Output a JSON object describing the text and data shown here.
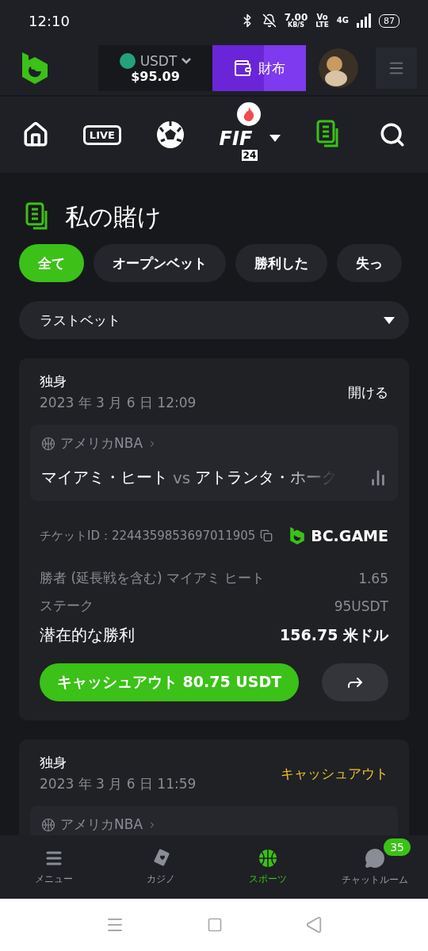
{
  "status_bar": {
    "time": "12:10",
    "speed": "7.00",
    "speed_unit": "KB/S",
    "volte_top": "Vo",
    "volte_bottom": "LTE",
    "network": "4G",
    "battery": "87"
  },
  "header": {
    "currency": "USDT",
    "balance": "$95.09",
    "wallet_label": "財布"
  },
  "top_nav": [
    {
      "kind": "home",
      "selected": false
    },
    {
      "kind": "live",
      "label": "LIVE",
      "selected": false
    },
    {
      "kind": "soccer",
      "selected": false
    },
    {
      "kind": "fifa",
      "label": "FIF",
      "sub": "24",
      "selected": false
    },
    {
      "kind": "bets",
      "selected": true
    },
    {
      "kind": "search",
      "selected": false
    }
  ],
  "page_title": "私の賭け",
  "filters": [
    {
      "label": "全て",
      "selected": true
    },
    {
      "label": "オープンベット",
      "selected": false
    },
    {
      "label": "勝利した",
      "selected": false
    },
    {
      "label": "失っ",
      "selected": false
    }
  ],
  "sort_select": {
    "value": "ラストベット"
  },
  "bets": [
    {
      "type": "独身",
      "date": "2023 年 3 月 6 日 12:09",
      "status": "開ける",
      "color": "#ffffff",
      "league": "アメリカNBA",
      "home": "マイアミ・ヒート",
      "vs": "vs",
      "away": "アトランタ・ホーク",
      "ticket": "チケットID：2244359853697011905",
      "brand": "BC.GAME",
      "selection": "勝者 (延長戦を含む) マイアミ ヒート",
      "odds": "1.65",
      "stake_label": "ステーク",
      "stake": "95USDT",
      "win_label": "潜在的な勝利",
      "win": "156.75 米ドル",
      "cashout": "キャッシュアウト 80.75 USDT"
    },
    {
      "type": "独身",
      "date": "2023 年 3 月 6 日 11:59",
      "status": "キャッシュアウト",
      "color": "#f0c22e",
      "league": "アメリカNBA"
    }
  ],
  "bottom_nav": [
    {
      "kind": "menu",
      "label": "メニュー",
      "selected": false
    },
    {
      "kind": "casino",
      "label": "カジノ",
      "selected": false
    },
    {
      "kind": "sports",
      "label": "スポーツ",
      "selected": true
    },
    {
      "kind": "chat",
      "label": "チャットルーム",
      "selected": false,
      "badge": "35"
    }
  ]
}
